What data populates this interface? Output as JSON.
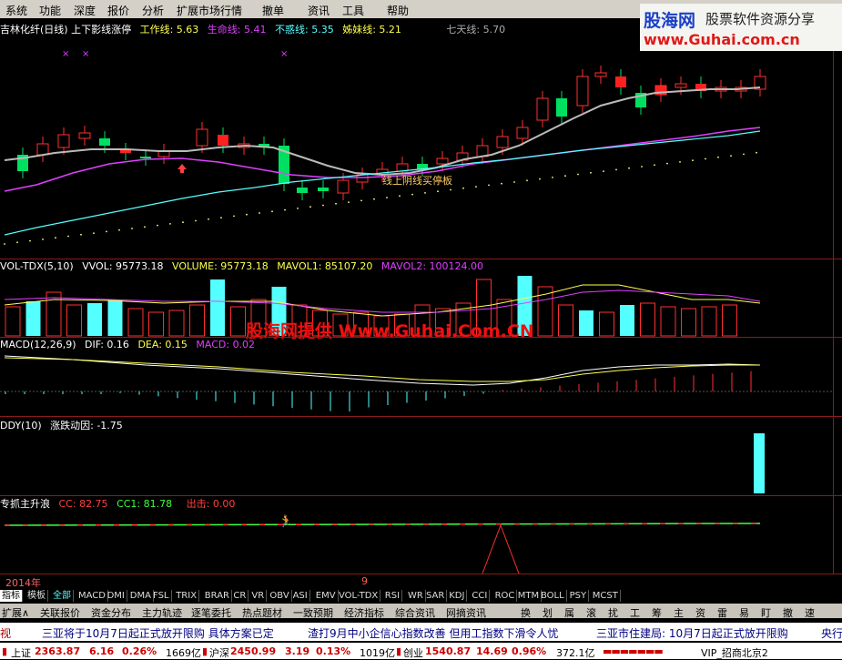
{
  "menu": [
    "系统",
    "功能",
    "深度",
    "报价",
    "分析",
    "扩展市场行情",
    "撤单",
    "资讯",
    "工具",
    "帮助"
  ],
  "logo": {
    "name": "股海网",
    "tagline": "股票软件资源分享",
    "url": "www.Guhai.com.cn"
  },
  "main_title": {
    "stock": "吉林化纤(日线) 上下影线涨停",
    "l1": "工作线: 5.63",
    "l2": "生命线: 5.41",
    "l3": "不惑线: 5.35",
    "l4": "姊妹线: 5.21",
    "l5": "七天线: 5.70"
  },
  "main_annotation": "线上阴线买停板",
  "vol_title": {
    "name": "VOL-TDX(5,10)",
    "v1": "VVOL: 95773.18",
    "v2": "VOLUME: 95773.18",
    "v3": "MAVOL1: 85107.20",
    "v4": "MAVOL2: 100124.00"
  },
  "macd_title": {
    "name": "MACD(12,26,9)",
    "v1": "DIF: 0.16",
    "v2": "DEA: 0.15",
    "v3": "MACD: 0.02"
  },
  "ddy_title": {
    "name": "DDY(10)",
    "v1": "涨跌动因: -1.75"
  },
  "zs_title": {
    "name": "专抓主升浪",
    "v1": "CC: 82.75",
    "v2": "CC1: 81.78",
    "v3": "出击: 0.00"
  },
  "watermark": "股海网提供 Www.Guhai.Com.CN",
  "date_left": "2014年",
  "date_mid": "9",
  "tabs_row1": [
    "指标",
    "模板",
    "全部",
    "MACD",
    "DMI",
    "DMA",
    "FSL",
    "TRIX",
    "BRAR",
    "CR",
    "VR",
    "OBV",
    "ASI",
    "EMV",
    "VOL-TDX",
    "RSI",
    "WR",
    "SAR",
    "KDJ",
    "CCI",
    "ROC",
    "MTM",
    "BOLL",
    "PSY",
    "MCST"
  ],
  "tabs_row2": [
    "扩展∧",
    "关联报价",
    "资金分布",
    "主力轨迹",
    "逐笔委托",
    "热点题材",
    "一致预期",
    "经济指标",
    "综合资讯",
    "网摘资讯"
  ],
  "tabs_row2_right": [
    "换",
    "划",
    "属",
    "滚",
    "扰",
    "工",
    "筹",
    "主",
    "资",
    "雷",
    "易",
    "盯",
    "撤",
    "速"
  ],
  "news": [
    "视",
    "三亚将于10月7日起正式放开限购 具体方案已定",
    "渣打9月中小企信心指数改善 但用工指数下滑令人忧",
    "三亚市住建局: 10月7日起正式放开限购",
    "央行"
  ],
  "status": {
    "sh_label": "上证",
    "sh_val": "2363.87",
    "sh_chg": "6.16",
    "sh_pct": "0.26%",
    "sh_amt": "1669亿",
    "sz_label": "沪深",
    "sz_val": "2450.99",
    "sz_chg": "3.19",
    "sz_pct": "0.13%",
    "sz_amt": "1019亿",
    "cy_label": "创业",
    "cy_val": "1540.87",
    "cy_chg": "14.69",
    "cy_pct": "0.96%",
    "cy_amt": "372.1亿",
    "broker": "VIP_招商北京2"
  },
  "colors": {
    "up": "#ff2a2a",
    "down": "#00e060",
    "cyan": "#54ffff",
    "magenta": "#e040ff",
    "yellow": "#ffff50",
    "grid": "#8b1a1a"
  }
}
